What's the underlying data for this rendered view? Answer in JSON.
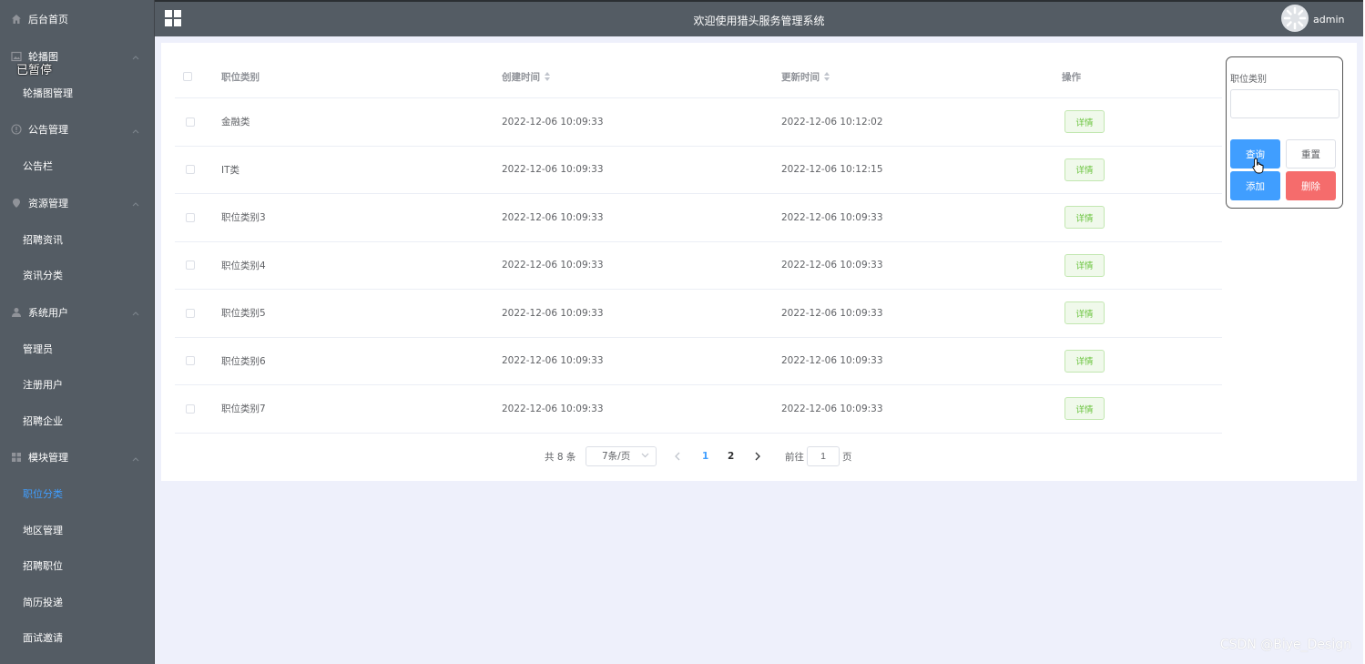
{
  "header": {
    "title": "欢迎使用猎头服务管理系统",
    "user": "admin"
  },
  "sidebar": {
    "overlay_text": "已暂停",
    "groups": [
      {
        "label": "后台首页",
        "icon": "home-icon",
        "items": []
      },
      {
        "label": "轮播图",
        "icon": "image-icon",
        "items": [
          "轮播图管理"
        ]
      },
      {
        "label": "公告管理",
        "icon": "info-icon",
        "items": [
          "公告栏"
        ]
      },
      {
        "label": "资源管理",
        "icon": "location-icon",
        "items": [
          "招聘资讯",
          "资讯分类"
        ]
      },
      {
        "label": "系统用户",
        "icon": "user-icon",
        "items": [
          "管理员",
          "注册用户",
          "招聘企业"
        ]
      },
      {
        "label": "模块管理",
        "icon": "grid-icon",
        "items": [
          "职位分类",
          "地区管理",
          "招聘职位",
          "简历投递",
          "面试邀请"
        ]
      }
    ],
    "active_item": "职位分类"
  },
  "table": {
    "headers": {
      "category": "职位类别",
      "created": "创建时间",
      "updated": "更新时间",
      "action": "操作"
    },
    "rows": [
      {
        "category": "金融类",
        "created": "2022-12-06 10:09:33",
        "updated": "2022-12-06 10:12:02",
        "action": "详情"
      },
      {
        "category": "IT类",
        "created": "2022-12-06 10:09:33",
        "updated": "2022-12-06 10:12:15",
        "action": "详情"
      },
      {
        "category": "职位类别3",
        "created": "2022-12-06 10:09:33",
        "updated": "2022-12-06 10:09:33",
        "action": "详情"
      },
      {
        "category": "职位类别4",
        "created": "2022-12-06 10:09:33",
        "updated": "2022-12-06 10:09:33",
        "action": "详情"
      },
      {
        "category": "职位类别5",
        "created": "2022-12-06 10:09:33",
        "updated": "2022-12-06 10:09:33",
        "action": "详情"
      },
      {
        "category": "职位类别6",
        "created": "2022-12-06 10:09:33",
        "updated": "2022-12-06 10:09:33",
        "action": "详情"
      },
      {
        "category": "职位类别7",
        "created": "2022-12-06 10:09:33",
        "updated": "2022-12-06 10:09:33",
        "action": "详情"
      }
    ]
  },
  "pagination": {
    "total": "共 8 条",
    "page_size": "7条/页",
    "pages": [
      "1",
      "2"
    ],
    "current_page": "1",
    "goto_label": "前往",
    "goto_value": "1",
    "page_unit": "页"
  },
  "search": {
    "label": "职位类别",
    "value": "",
    "query": "查询",
    "reset": "重置",
    "add": "添加",
    "delete": "删除"
  },
  "watermark": "CSDN @Biye_Design",
  "colors": {
    "sidebar_bg": "#545c64",
    "primary": "#409eff",
    "danger": "#f56c6c",
    "success": "#67c23a"
  }
}
